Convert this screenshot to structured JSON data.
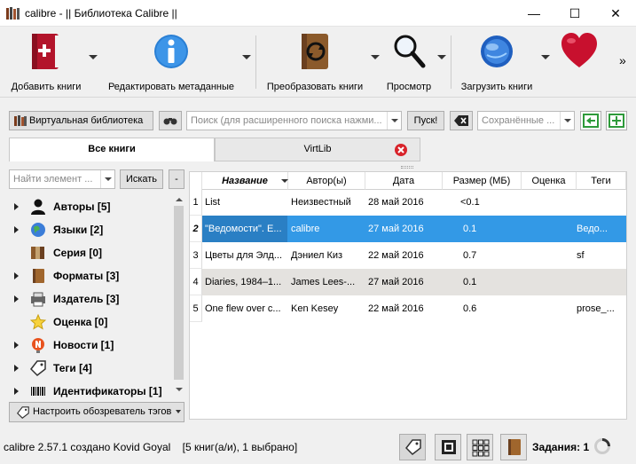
{
  "window": {
    "title": "calibre - || Библиотека Calibre ||",
    "minimize": "—",
    "maximize": "☐",
    "close": "✕"
  },
  "toolbar": {
    "add_books": "Добавить книги",
    "edit_metadata": "Редактировать метаданные",
    "convert_books": "Преобразовать книги",
    "view": "Просмотр",
    "get_books": "Загрузить книги",
    "more": "»"
  },
  "searchbar": {
    "virtual_library": "Виртуальная библиотека",
    "search_placeholder": "Поиск (для расширенного поиска нажми...",
    "search_button": "Пуск!",
    "saved_searches_placeholder": "Сохранённые ..."
  },
  "tabs": [
    {
      "label": "Все книги"
    },
    {
      "label": "VirtLib"
    }
  ],
  "tag_browser": {
    "find_placeholder": "Найти элемент ...",
    "find_button": "Искать",
    "collapse_button": "-",
    "items": [
      {
        "label": "Авторы [5]",
        "icon": "person-icon"
      },
      {
        "label": "Языки [2]",
        "icon": "globe-icon"
      },
      {
        "label": "Серия [0]",
        "icon": "series-icon"
      },
      {
        "label": "Форматы [3]",
        "icon": "book-icon"
      },
      {
        "label": "Издатель [3]",
        "icon": "printer-icon"
      },
      {
        "label": "Оценка [0]",
        "icon": "star-icon"
      },
      {
        "label": "Новости [1]",
        "icon": "news-icon"
      },
      {
        "label": "Теги [4]",
        "icon": "tag-icon"
      },
      {
        "label": "Идентификаторы [1]",
        "icon": "barcode-icon"
      }
    ],
    "configure_button": "Настроить обозреватель тэгов"
  },
  "book_list": {
    "columns": [
      "Название",
      "Автор(ы)",
      "Дата",
      "Размер (МБ)",
      "Оценка",
      "Теги"
    ],
    "rows": [
      {
        "num": "1",
        "title": "List",
        "author": "Неизвестный",
        "date": "28 май 2016",
        "size": "<0.1",
        "rating": "",
        "tags": ""
      },
      {
        "num": "2",
        "title": "\"Ведомости\". E...",
        "author": "calibre",
        "date": "27 май 2016",
        "size": "0.1",
        "rating": "",
        "tags": "Ведо..."
      },
      {
        "num": "3",
        "title": "Цветы для Элд...",
        "author": "Дэниел Киз",
        "date": "22 май 2016",
        "size": "0.7",
        "rating": "",
        "tags": "sf"
      },
      {
        "num": "4",
        "title": "Diaries, 1984–1...",
        "author": "James Lees-...",
        "date": "27 май 2016",
        "size": "0.1",
        "rating": "",
        "tags": ""
      },
      {
        "num": "5",
        "title": "One flew over c...",
        "author": "Ken Kesey",
        "date": "22 май 2016",
        "size": "0.6",
        "rating": "",
        "tags": "prose_..."
      }
    ]
  },
  "status": {
    "left_text": "calibre 2.57.1 создано Kovid Goyal    [5 книг(а/и), 1 выбрано]",
    "jobs": "Задания: 1"
  },
  "colors": {
    "selection": "#3399e6",
    "hover_row": "#e4e2df",
    "accent_red": "#c8102e"
  }
}
